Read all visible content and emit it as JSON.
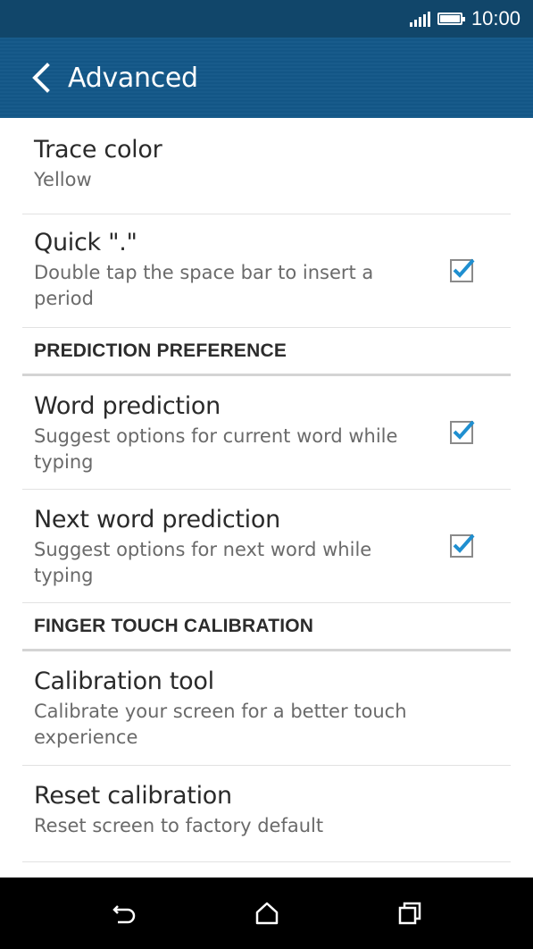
{
  "status_bar": {
    "time": "10:00"
  },
  "app_bar": {
    "title": "Advanced"
  },
  "items_top": [
    {
      "title": "Trace color",
      "subtitle": "Yellow"
    },
    {
      "title": "Quick \".\"",
      "subtitle": "Double tap the space bar to insert a period",
      "checked": true
    }
  ],
  "sections": {
    "prediction": "PREDICTION PREFERENCE",
    "calibration": "FINGER TOUCH CALIBRATION"
  },
  "prediction_items": [
    {
      "title": "Word prediction",
      "subtitle": "Suggest options for current word while typing",
      "checked": true
    },
    {
      "title": "Next word prediction",
      "subtitle": "Suggest options for next word while typing",
      "checked": true
    }
  ],
  "calibration_items": [
    {
      "title": "Calibration tool",
      "subtitle": "Calibrate your screen for a better touch experience"
    },
    {
      "title": "Reset calibration",
      "subtitle": "Reset screen to factory default"
    }
  ],
  "colors": {
    "status_bar": "#11466a",
    "app_bar": "#135889",
    "checkbox_check": "#1f8fd0"
  },
  "icons": {
    "back": "chevron-left-icon",
    "nav_back": "back-arrow-icon",
    "nav_home": "home-icon",
    "nav_recents": "recents-icon"
  }
}
